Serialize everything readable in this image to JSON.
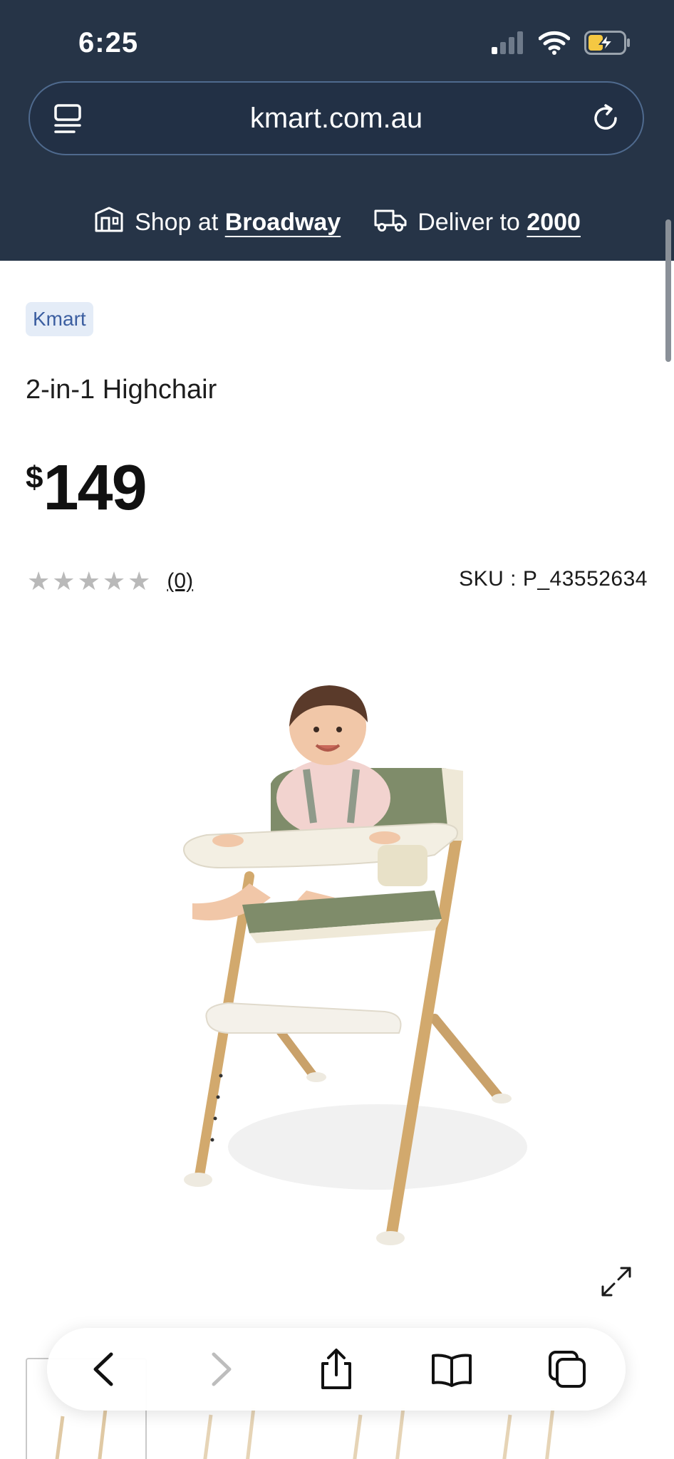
{
  "status_bar": {
    "time": "6:25"
  },
  "browser": {
    "url": "kmart.com.au"
  },
  "store_bar": {
    "shop_prefix": "Shop at",
    "shop_store": "Broadway",
    "deliver_prefix": "Deliver to",
    "deliver_postcode": "2000"
  },
  "product": {
    "brand": "Kmart",
    "title": "2-in-1 Highchair",
    "price_currency": "$",
    "price_amount": "149",
    "rating_stars_filled": 0,
    "rating_stars_total": 5,
    "review_count": "(0)",
    "sku": "SKU : P_43552634"
  },
  "icons": {
    "signal": "signal-icon",
    "wifi": "wifi-icon",
    "battery": "battery-charging-icon",
    "menu": "page-menu-icon",
    "reload": "reload-icon",
    "store": "store-icon",
    "truck": "delivery-truck-icon",
    "expand": "expand-icon",
    "back": "back-icon",
    "forward": "forward-icon",
    "share": "share-icon",
    "bookmarks": "bookmarks-icon",
    "tabs": "tabs-icon"
  },
  "colors": {
    "header_bg": "#263447",
    "brand_chip_bg": "#e4ecf7",
    "brand_chip_text": "#3b5ea0",
    "star_empty": "#b9b9b9"
  }
}
